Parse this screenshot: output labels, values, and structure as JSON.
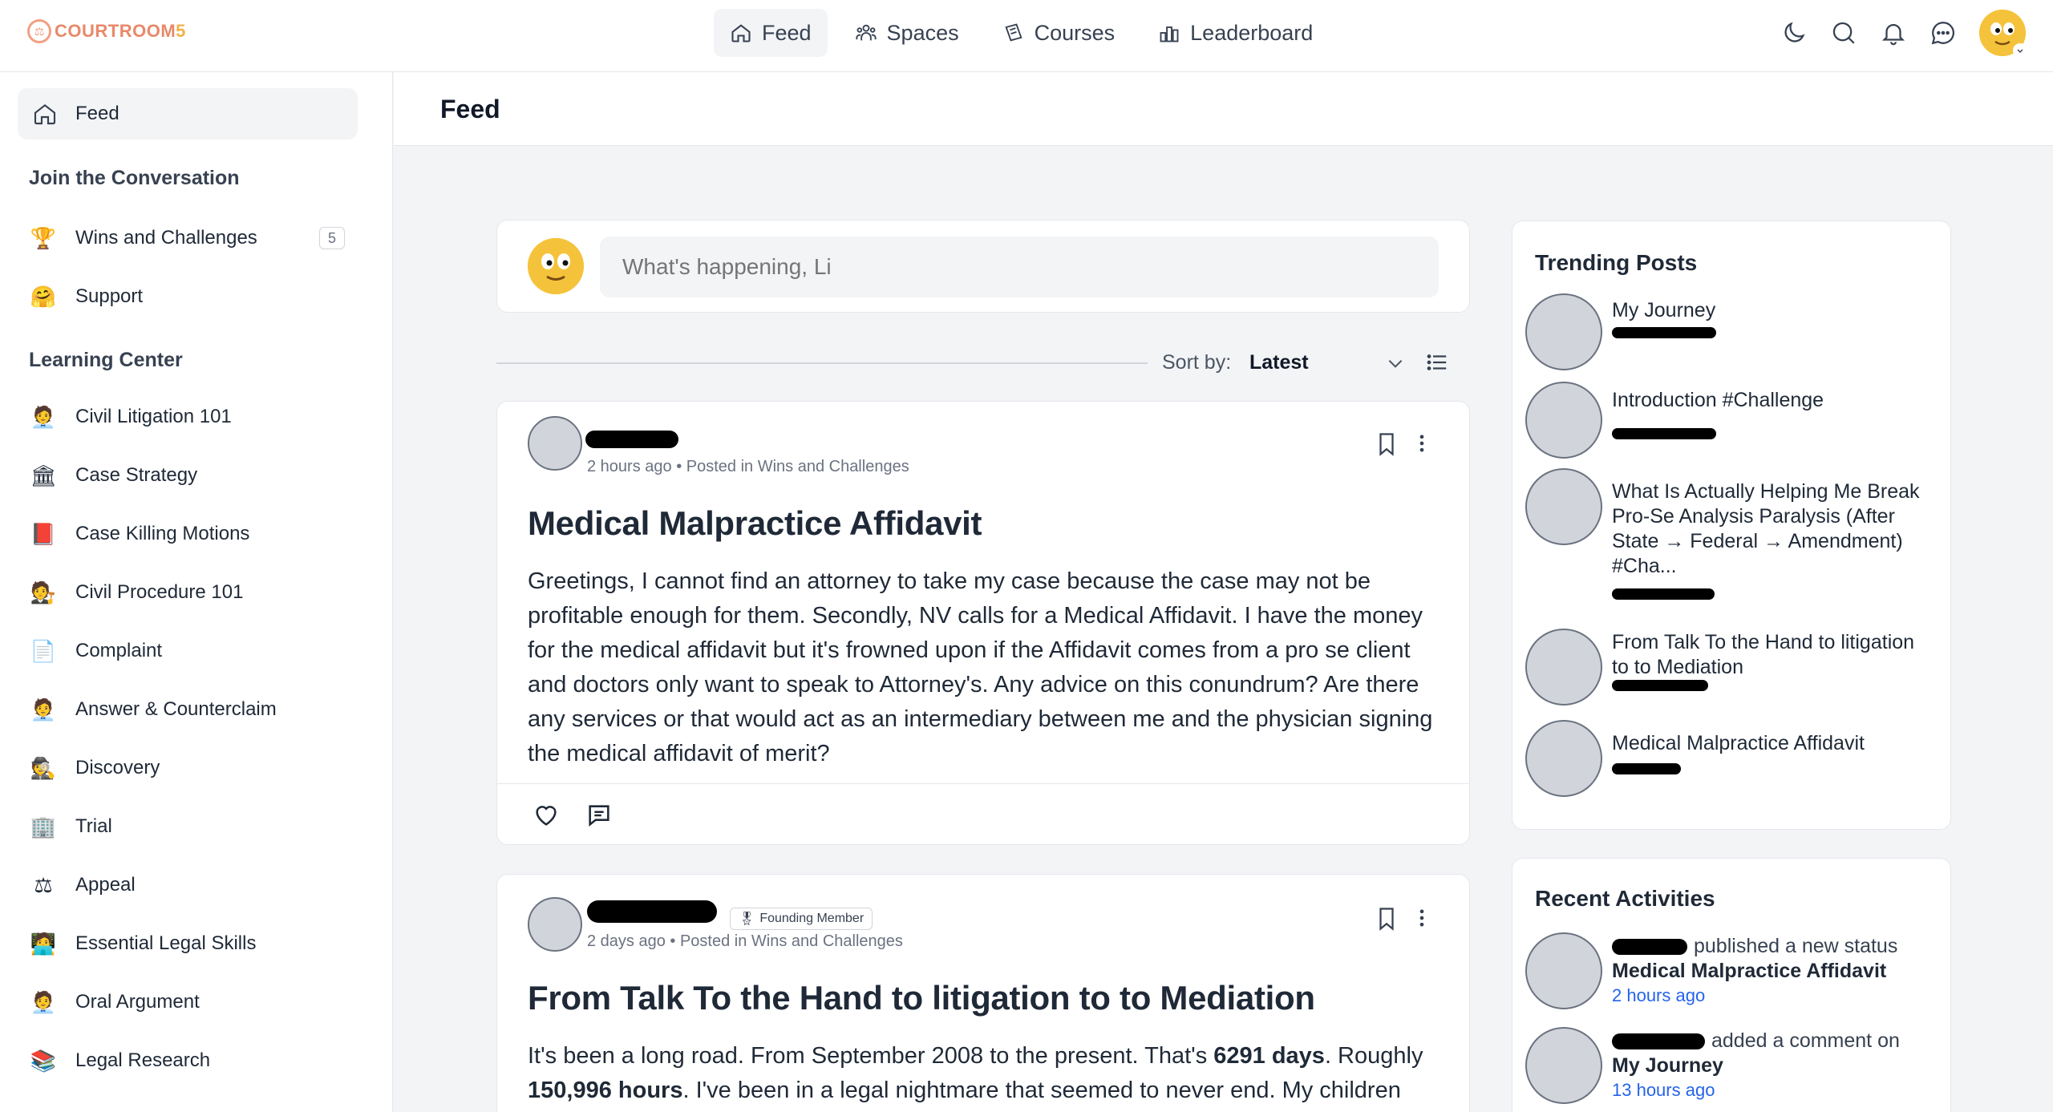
{
  "brand": {
    "name_main": "COURTROOM",
    "name_suffix": "5",
    "accent": "#e8896a"
  },
  "nav": [
    {
      "label": "Feed",
      "icon": "home-icon",
      "active": true
    },
    {
      "label": "Spaces",
      "icon": "users-icon"
    },
    {
      "label": "Courses",
      "icon": "courses-icon"
    },
    {
      "label": "Leaderboard",
      "icon": "leaderboard-icon"
    }
  ],
  "top_icons": [
    "moon-icon",
    "search-icon",
    "bell-icon",
    "chat-icon",
    "user-avatar"
  ],
  "sidebar": {
    "feed_label": "Feed",
    "section1_title": "Join the Conversation",
    "section1": [
      {
        "label": "Wins and Challenges",
        "icon": "🏆",
        "count": "5"
      },
      {
        "label": "Support",
        "icon": "🤗"
      }
    ],
    "section2_title": "Learning Center",
    "section2": [
      {
        "label": "Civil Litigation 101",
        "icon": "🧑‍💼"
      },
      {
        "label": "Case Strategy",
        "icon": "🏛"
      },
      {
        "label": "Case Killing Motions",
        "icon": "📕"
      },
      {
        "label": "Civil Procedure 101",
        "icon": "🧑‍⚖"
      },
      {
        "label": "Complaint",
        "icon": "📄"
      },
      {
        "label": "Answer & Counterclaim",
        "icon": "🧑‍💼"
      },
      {
        "label": "Discovery",
        "icon": "🕵"
      },
      {
        "label": "Trial",
        "icon": "🏢"
      },
      {
        "label": "Appeal",
        "icon": "⚖"
      },
      {
        "label": "Essential Legal Skills",
        "icon": "🧑‍💻"
      },
      {
        "label": "Oral Argument",
        "icon": "🧑‍💼"
      },
      {
        "label": "Legal Research",
        "icon": "📚"
      }
    ]
  },
  "main": {
    "title": "Feed"
  },
  "composer": {
    "placeholder": "What's happening, Li"
  },
  "sort": {
    "label": "Sort by:",
    "value": "Latest"
  },
  "posts": [
    {
      "meta": "2 hours ago • Posted in Wins and Challenges",
      "title": "Medical Malpractice Affidavit",
      "body": "Greetings, I cannot find an attorney to take my case because the case may not be profitable enough for them. Secondly, NV calls for a Medical Affidavit. I have the money for the medical affidavit but it's frowned upon if the Affidavit comes from a pro se client and doctors only want to speak to Attorney's. Any advice on this conundrum? Are there any services or that would act as an intermediary between me and the physician signing the medical affidavit of merit?"
    },
    {
      "badge": "Founding Member",
      "meta": "2 days ago • Posted in Wins and Challenges",
      "title": "From Talk To the Hand to litigation to to Mediation",
      "body_p1": "It's been a long road. From September 2008 to the present. That's ",
      "body_b1": "6291 days",
      "body_p2": ". Roughly ",
      "body_b2": "150,996 hours",
      "body_p3": ". I've been in a legal nightmare that seemed to never end. My children"
    }
  ],
  "trending": {
    "title": "Trending Posts",
    "items": [
      {
        "title": "My Journey"
      },
      {
        "title": "Introduction #Challenge"
      },
      {
        "title": "What Is Actually Helping Me Break Pro-Se Analysis Paralysis (After State → Federal → Amendment) #Cha..."
      },
      {
        "title": "From Talk To the Hand to litigation to to Mediation"
      },
      {
        "title": "Medical Malpractice Affidavit"
      }
    ]
  },
  "recent": {
    "title": "Recent Activities",
    "items": [
      {
        "action": "published a new status",
        "target": "Medical Malpractice Affidavit",
        "time": "2 hours ago"
      },
      {
        "action": "added a comment on",
        "target": "My Journey",
        "time": "13 hours ago"
      }
    ]
  }
}
